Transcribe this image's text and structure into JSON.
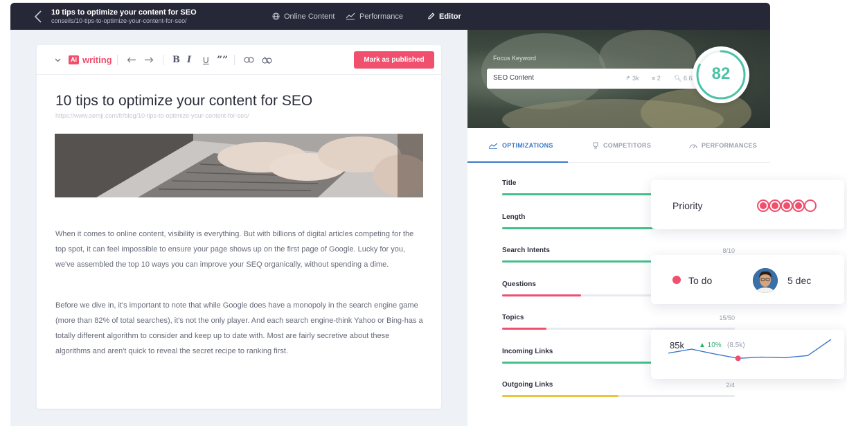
{
  "topbar": {
    "title": "10 tips to optimize your content for SEO",
    "url": "conseils/10-tips-to-optimize-your-content-for-seo/",
    "nav": [
      "Online Content",
      "Performance",
      "Editor"
    ]
  },
  "editor": {
    "ai_label": "writing",
    "ai_badge": "AI",
    "publish_label": "Mark as published",
    "toolbar": {
      "bold": "B",
      "italic": "I",
      "underline": "U",
      "quote": "””"
    },
    "article_title": "10 tips to optimize your content for SEO",
    "article_url": "https://www.semji.com/fr/blog/10-tips-to-optimize-your-content-for-seo/",
    "paragraphs": [
      "When it comes to online content, visibility is everything. But with billions of digital articles competing for the top spot, it can feel impossible to ensure your page shows up on the first page of Google. Lucky for you, we've assembled the top 10 ways you can improve your SEQ organically, without spending a dime.",
      "Before we dive in, it's important to note that while Google does have a monopoly in the search engine game (more than 82% of total searches), it's not the only player. And each search engine-think Yahoo or Bing-has a totally different algorithm to consider and keep up to date with. Most are fairly secretive about these algorithms and aren't quick to reveal the secret recipe to ranking first."
    ]
  },
  "focus": {
    "label": "Focus Keyword",
    "keyword": "SEO Content",
    "stats": [
      "3k",
      "2",
      "6.6k"
    ],
    "score": "82",
    "score_fraction": 0.82
  },
  "tabs": [
    "OPTIMIZATIONS",
    "COMPETITORS",
    "PERFORMANCES"
  ],
  "criteria": [
    {
      "label": "Title",
      "count": "",
      "fill": 0.7,
      "color": "#43c08a"
    },
    {
      "label": "Length",
      "count": "",
      "fill": 0.75,
      "color": "#43c08a"
    },
    {
      "label": "Search Intents",
      "count": "8/10",
      "fill": 0.8,
      "color": "#43c08a"
    },
    {
      "label": "Questions",
      "count": "",
      "fill": 0.34,
      "color": "#f04f6e"
    },
    {
      "label": "Topics",
      "count": "15/50",
      "fill": 0.19,
      "color": "#f04f6e"
    },
    {
      "label": "Incoming Links",
      "count": "",
      "fill": 0.7,
      "color": "#43c08a"
    },
    {
      "label": "Outgoing Links",
      "count": "2/4",
      "fill": 0.5,
      "color": "#e9c53b"
    }
  ],
  "priority": {
    "label": "Priority",
    "level": 4,
    "max": 5
  },
  "status": {
    "label": "To do",
    "date": "5 dec"
  },
  "traffic": {
    "value": "85k",
    "delta": "▲ 10%",
    "previous": "(8.5k)",
    "points": [
      0.55,
      0.68,
      0.52,
      0.38,
      0.42,
      0.4,
      0.47,
      1.0
    ]
  }
}
